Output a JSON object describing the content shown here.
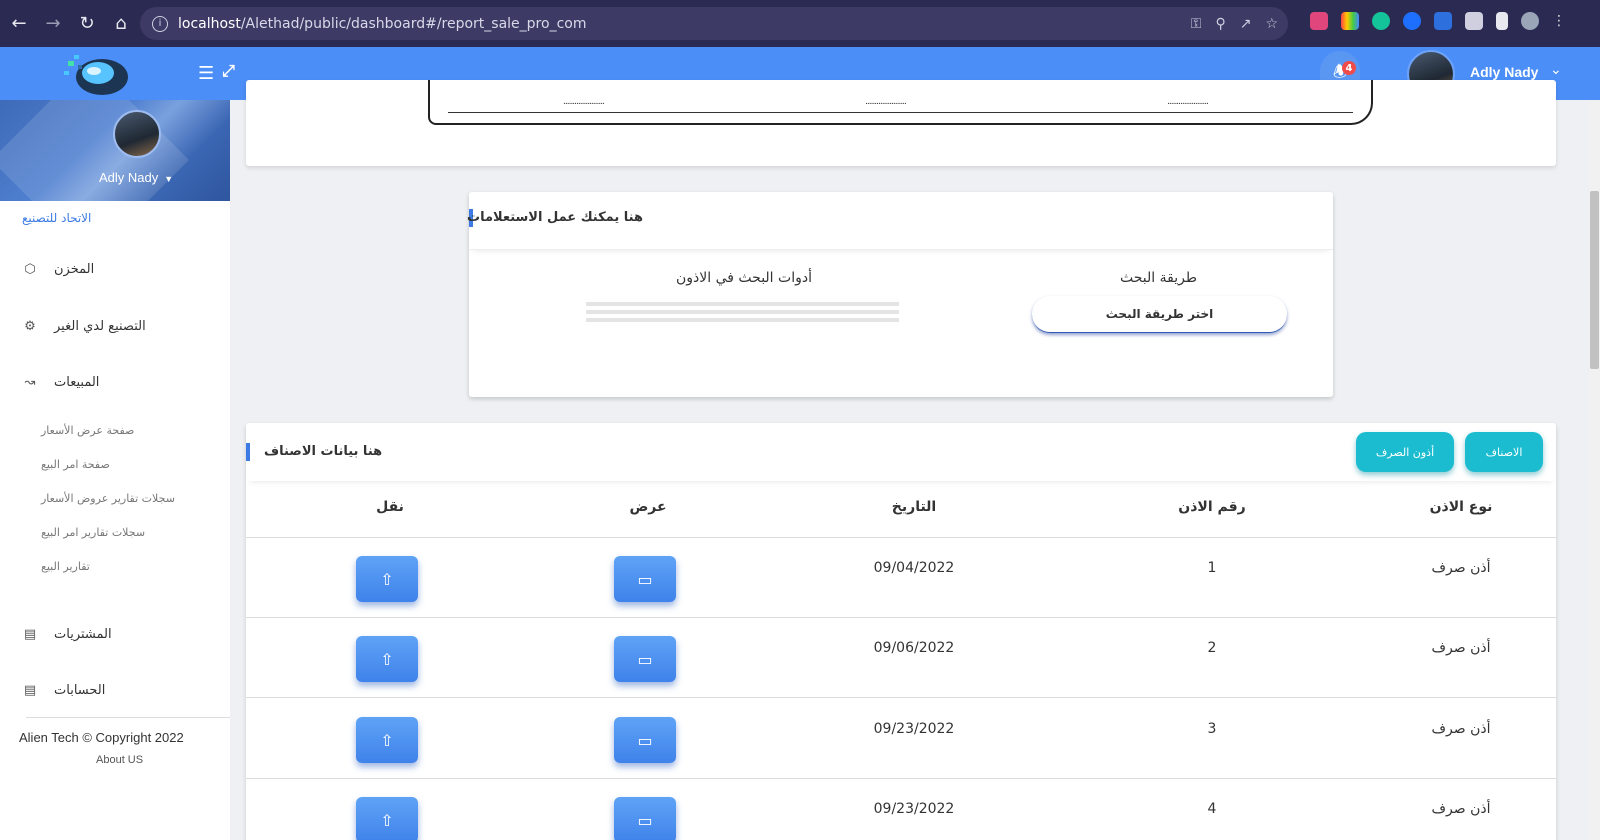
{
  "browser": {
    "url_host": "localhost",
    "url_path": "/Alethad/public/dashboard#/report_sale_pro_com"
  },
  "header": {
    "user_name": "Adly Nady",
    "notification_count": "4"
  },
  "sidebar": {
    "user_name": "Adly Nady",
    "company": "الاتحاد للتصنيع",
    "items": [
      {
        "label": "المخزن",
        "icon": "cube-icon"
      },
      {
        "label": "التصنيع لدي الغير",
        "icon": "gear-icon"
      },
      {
        "label": "المبيعات",
        "icon": "chart-line-icon"
      },
      {
        "label": "المشتريات",
        "icon": "card-icon"
      },
      {
        "label": "الحسابات",
        "icon": "card-icon"
      }
    ],
    "sales_sub": [
      "صفحة عرض الأسعار",
      "صفحة امر البيع",
      "سجلات تقارير عروض الأسعار",
      "سجلات تقارير امر البيع",
      "تقارير البيع"
    ],
    "copyright": "Alien Tech © Copyright 2022",
    "about": "About US"
  },
  "report_paper": {
    "dots": [
      "......................",
      "......................",
      "......................"
    ]
  },
  "search": {
    "title": "هنا يمكنك عمل الاستعلامات",
    "method_label": "طريقة البحث",
    "method_button": "اختر طريقة البحث",
    "tools_label": "أدوات البحث في الاذون"
  },
  "table": {
    "title": "هنا بيانات الاصناف",
    "buttons": {
      "categories": "الاصناف",
      "issue_permits": "أذون الصرف"
    },
    "columns": {
      "type": "نوع الاذن",
      "number": "رقم الاذن",
      "date": "التاريخ",
      "view": "عرض",
      "move": "نقل"
    },
    "rows": [
      {
        "type": "أذن صرف",
        "number": "1",
        "date": "09/04/2022"
      },
      {
        "type": "أذن صرف",
        "number": "2",
        "date": "09/06/2022"
      },
      {
        "type": "أذن صرف",
        "number": "3",
        "date": "09/23/2022"
      },
      {
        "type": "أذن صرف",
        "number": "4",
        "date": "09/23/2022"
      }
    ]
  },
  "colors": {
    "header": "#4c8ef7",
    "accent": "#3d7be4",
    "teal": "#1bbcd0",
    "chrome": "#2b2a52"
  }
}
